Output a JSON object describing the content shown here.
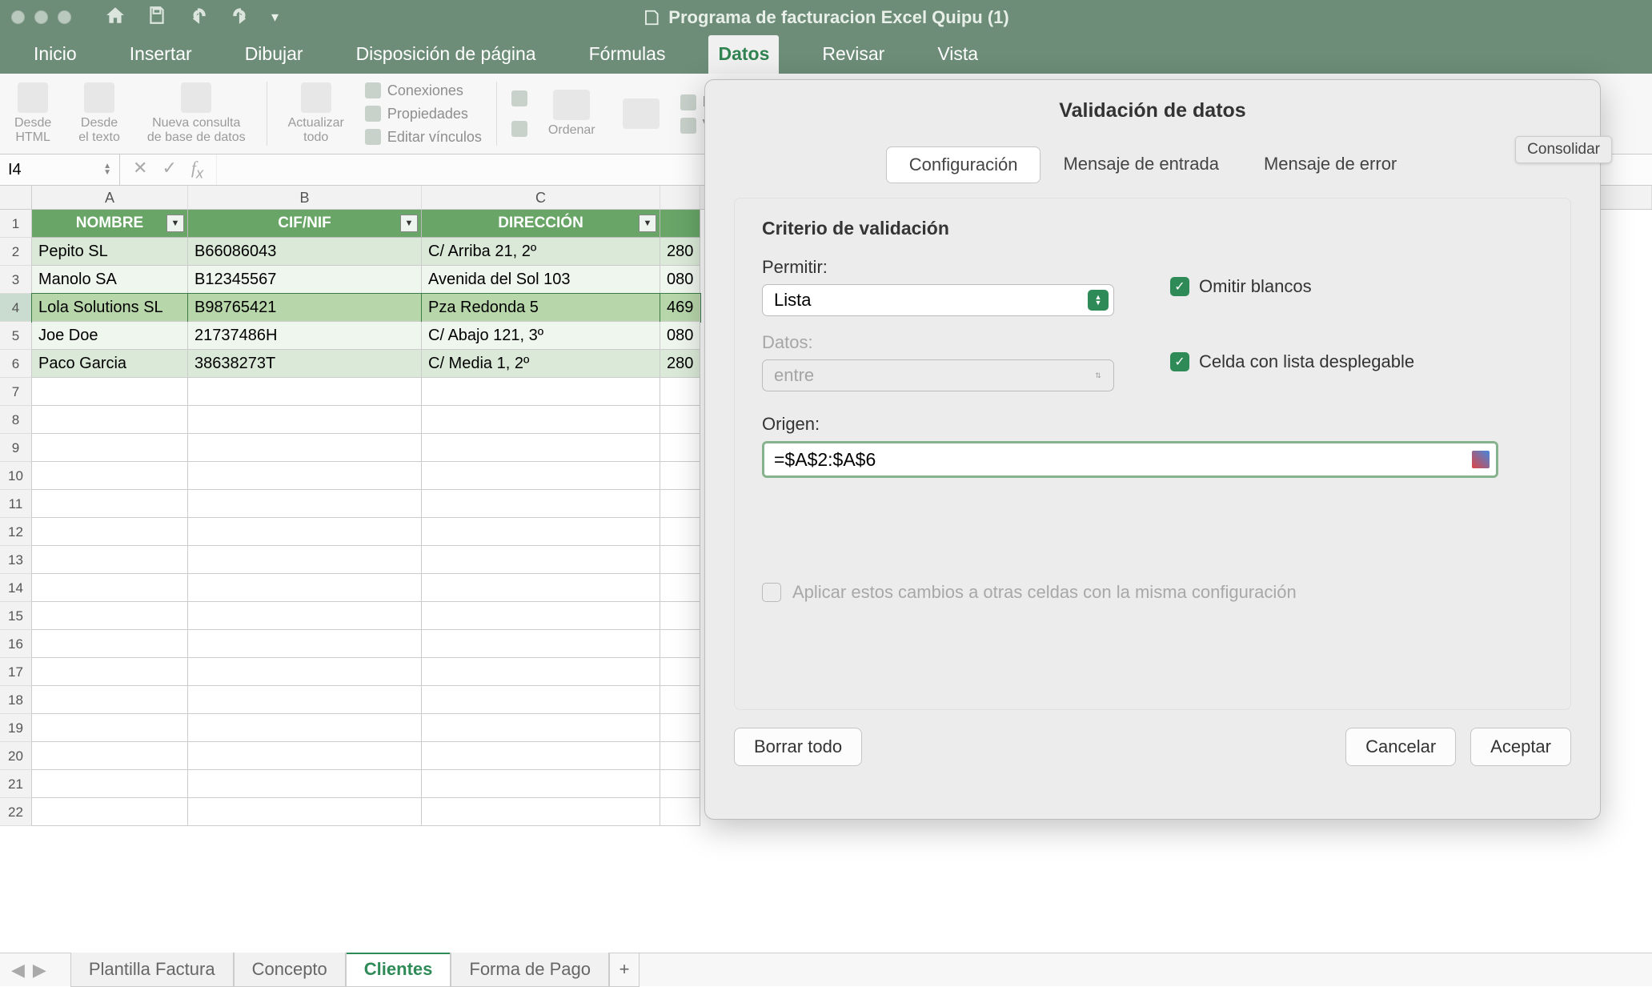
{
  "title": "Programa de facturacion Excel Quipu (1)",
  "ribbon_tabs": [
    "Inicio",
    "Insertar",
    "Dibujar",
    "Disposición de página",
    "Fórmulas",
    "Datos",
    "Revisar",
    "Vista"
  ],
  "ribbon": {
    "desde_html": "Desde\nHTML",
    "desde_texto": "Desde\nel texto",
    "nueva_consulta": "Nueva consulta\nde base de datos",
    "actualizar": "Actualizar\ntodo",
    "conexiones": "Conexiones",
    "propiedades": "Propiedades",
    "editar_vinc": "Editar vínculos",
    "ordenar": "Ordenar",
    "borrar": "Borrar",
    "volver": "Volver a aplicar"
  },
  "tooltip": "Consolidar",
  "name_box": "I4",
  "columns": [
    "A",
    "B",
    "C"
  ],
  "headers": {
    "a": "NOMBRE",
    "b": "CIF/NIF",
    "c": "DIRECCIÓN"
  },
  "rows": [
    {
      "a": "Pepito SL",
      "b": "B66086043",
      "c": "C/ Arriba 21, 2º",
      "d": "280"
    },
    {
      "a": "Manolo SA",
      "b": "B12345567",
      "c": "Avenida del Sol 103",
      "d": "080"
    },
    {
      "a": "Lola Solutions SL",
      "b": "B98765421",
      "c": "Pza Redonda 5",
      "d": "469"
    },
    {
      "a": "Joe Doe",
      "b": "21737486H",
      "c": "C/ Abajo 121, 3º",
      "d": "080"
    },
    {
      "a": "Paco Garcia",
      "b": "38638273T",
      "c": "C/ Media 1, 2º",
      "d": "280"
    }
  ],
  "sheet_tabs": [
    "Plantilla Factura",
    "Concepto",
    "Clientes",
    "Forma de Pago"
  ],
  "active_sheet": 2,
  "dialog": {
    "title": "Validación de datos",
    "tabs": [
      "Configuración",
      "Mensaje de entrada",
      "Mensaje de error"
    ],
    "criteria": "Criterio de validación",
    "permitir_label": "Permitir:",
    "permitir_value": "Lista",
    "datos_label": "Datos:",
    "datos_value": "entre",
    "origen_label": "Origen:",
    "origen_value": "=$A$2:$A$6",
    "omitir": "Omitir blancos",
    "celda_lista": "Celda con lista desplegable",
    "apply": "Aplicar estos cambios a otras celdas con la misma configuración",
    "borrar": "Borrar todo",
    "cancelar": "Cancelar",
    "aceptar": "Aceptar"
  }
}
